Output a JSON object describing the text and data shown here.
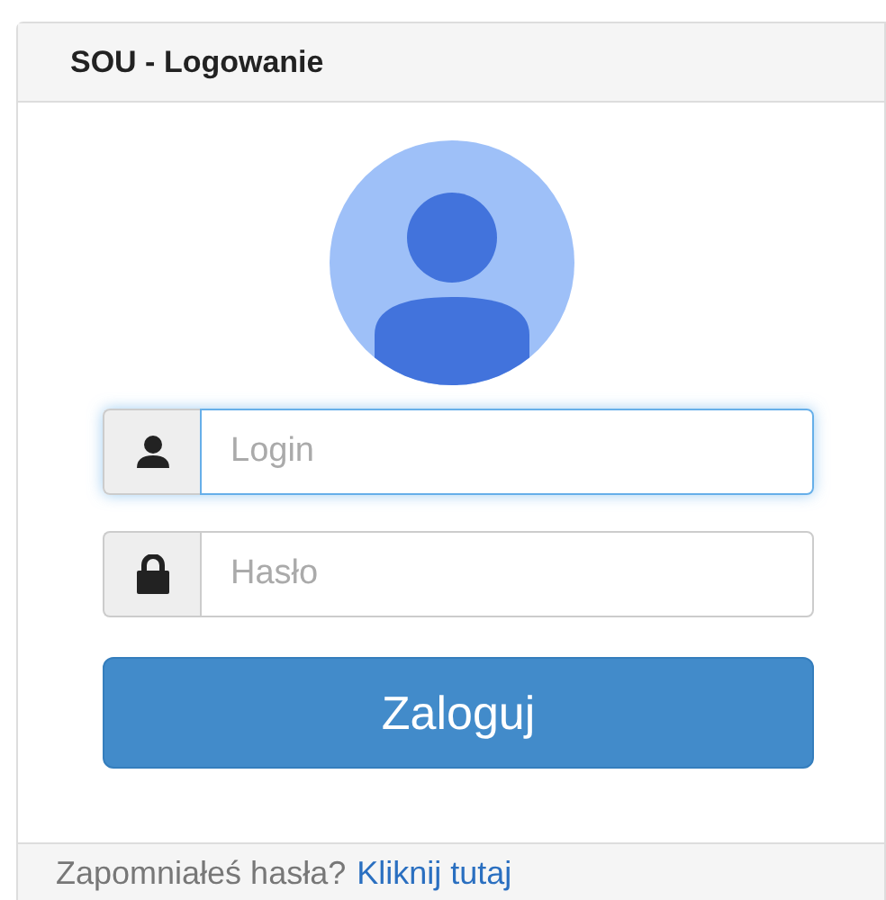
{
  "panel": {
    "title": "SOU - Logowanie"
  },
  "fields": [
    {
      "kind": "user",
      "placeholder": "Login",
      "focused": true
    },
    {
      "kind": "password",
      "placeholder": "Hasło",
      "focused": false
    }
  ],
  "submit_button": "Zaloguj",
  "footer": {
    "text": "Zapomniałeś hasła?",
    "link": "Kliknij tutaj"
  }
}
